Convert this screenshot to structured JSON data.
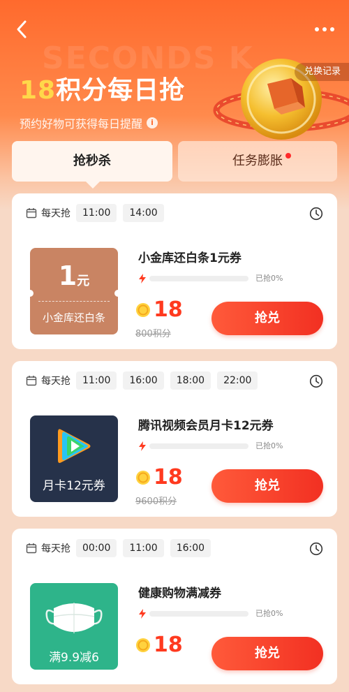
{
  "hero": {
    "watermark": "SECONDS K",
    "title_num": "18",
    "title_text": "积分每日抢",
    "subtitle": "预约好物可获得每日提醒",
    "info_glyph": "i",
    "history_label": "兑换记录",
    "colors": {
      "accent": "#ff6a2d",
      "highlight": "#ffd84a"
    }
  },
  "tabs": [
    {
      "label": "抢秒杀",
      "active": true
    },
    {
      "label": "任务膨胀",
      "active": false,
      "dot": true
    }
  ],
  "cards": [
    {
      "schedule_label": "每天抢",
      "times": [
        "11:00",
        "14:00"
      ],
      "thumb": {
        "value": "1",
        "unit": "元",
        "label": "小金库还白条"
      },
      "name": "小金库还白条1元券",
      "progress_text": "已抢0%",
      "progress": 0,
      "price": "18",
      "original_price": "800积分",
      "button": "抢兑"
    },
    {
      "schedule_label": "每天抢",
      "times": [
        "11:00",
        "16:00",
        "18:00",
        "22:00"
      ],
      "thumb": {
        "label": "月卡12元券"
      },
      "name": "腾讯视频会员月卡12元券",
      "progress_text": "已抢0%",
      "progress": 0,
      "price": "18",
      "original_price": "9600积分",
      "button": "抢兑"
    },
    {
      "schedule_label": "每天抢",
      "times": [
        "00:00",
        "11:00",
        "16:00"
      ],
      "thumb": {
        "label": "满9.9减6"
      },
      "name": "健康购物满减券",
      "progress_text": "已抢0%",
      "progress": 0,
      "price": "18",
      "button": "抢兑"
    }
  ]
}
